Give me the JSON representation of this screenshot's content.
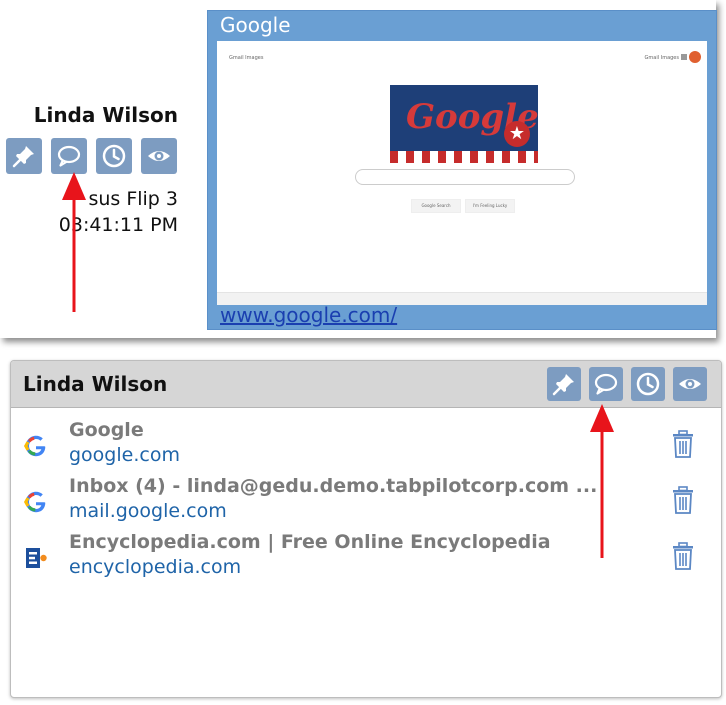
{
  "top_card": {
    "student_name": "Linda Wilson",
    "device_name": "sus Flip 3",
    "time": "03:41:11 PM",
    "icons": [
      "pin-icon",
      "chat-icon",
      "clock-icon",
      "eye-icon"
    ],
    "thumbnail": {
      "title": "Google",
      "url": "www.google.com/",
      "doodle_text": "Google",
      "mini_top_left": "Gmail  Images",
      "mini_top_right": "Gmail  Images",
      "mini_buttons": [
        "Google Search",
        "I'm Feeling Lucky"
      ]
    }
  },
  "panel": {
    "student_name": "Linda Wilson",
    "icons": [
      "pin-icon",
      "chat-icon",
      "clock-icon",
      "eye-icon"
    ],
    "tabs": [
      {
        "title": "Google",
        "url": "google.com",
        "favicon": "google-favicon"
      },
      {
        "title": "Inbox (4) - linda@gedu.demo.tabpilotcorp.com ...",
        "url": "mail.google.com",
        "favicon": "google-favicon"
      },
      {
        "title": "Encyclopedia.com | Free Online Encyclopedia",
        "url": "encyclopedia.com",
        "favicon": "encyclopedia-favicon"
      }
    ]
  },
  "colors": {
    "icon_button": "#7d9cc1",
    "thumbnail_frame": "#6a9fd3",
    "link": "#1f64a8",
    "annotation_arrow": "#e8141b"
  }
}
